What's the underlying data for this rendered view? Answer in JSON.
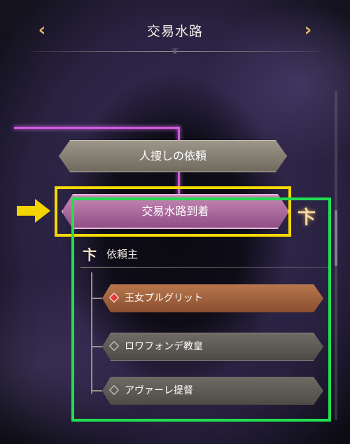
{
  "header": {
    "title": "交易水路",
    "prev_icon": "chevron-left-icon",
    "next_icon": "chevron-right-icon"
  },
  "route": {
    "items": [
      {
        "label": "人捜しの依頼"
      },
      {
        "label": "交易水路到着"
      }
    ]
  },
  "client_section": {
    "title": "依頼主",
    "options": [
      {
        "label": "王女プルグリット",
        "selected": true
      },
      {
        "label": "ロワフォンデ教皇",
        "selected": false
      },
      {
        "label": "アヴァーレ提督",
        "selected": false
      }
    ]
  },
  "colors": {
    "highlight_yellow": "#f5d800",
    "highlight_green": "#20e050",
    "accent_magenta": "#d05ae0"
  }
}
